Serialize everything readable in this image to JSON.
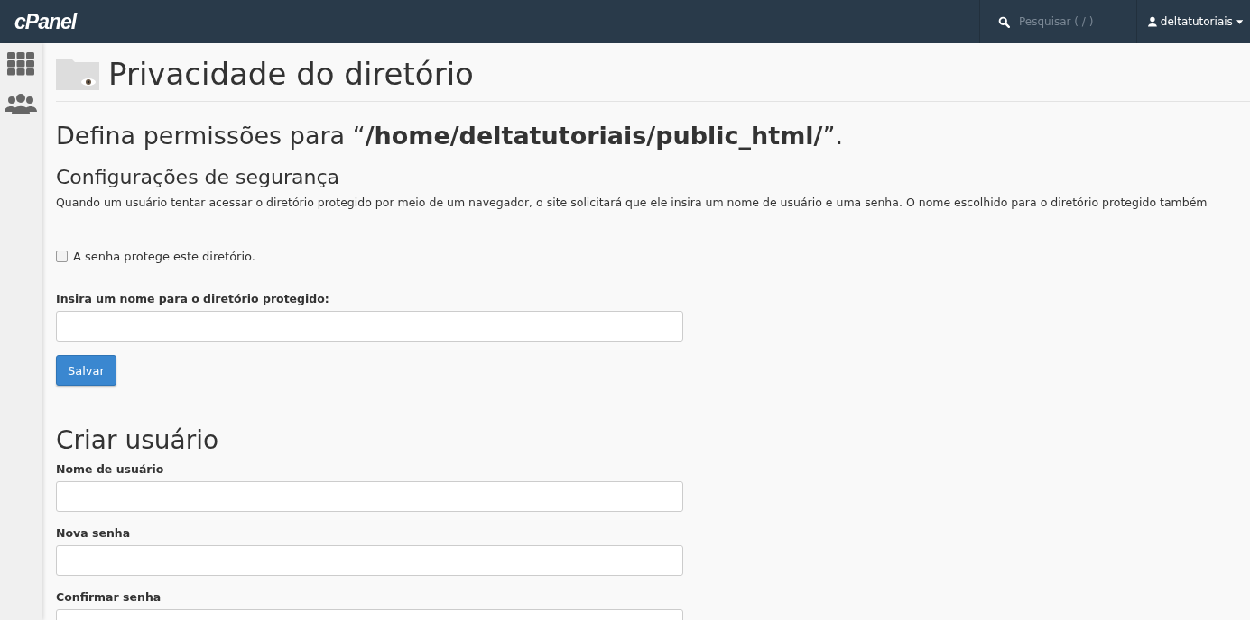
{
  "topbar": {
    "logo": "cPanel",
    "search": {
      "placeholder": "Pesquisar ( / )"
    },
    "user": "deltatutoriais"
  },
  "page": {
    "title": "Privacidade do diretório",
    "heading": "Defina permissões para “**/home/deltatutoriais/public_html/**”.",
    "security": {
      "title": "Configurações de segurança",
      "description": "Quando um usuário tentar acessar o diretório protegido por meio de um navegador, o site solicitará que ele insira um nome de usuário e uma senha. O nome escolhido para o diretório protegido também",
      "checkbox": {
        "label": "A senha protege este diretório.",
        "checked": false
      },
      "name_label": "Insira um nome para o diretório protegido:",
      "save_button": "Salvar"
    },
    "create_user": {
      "title": "Criar usuário",
      "fields": [
        {
          "label": "Nome de usuário"
        },
        {
          "label": "Nova senha"
        },
        {
          "label": "Confirmar senha"
        }
      ]
    }
  }
}
